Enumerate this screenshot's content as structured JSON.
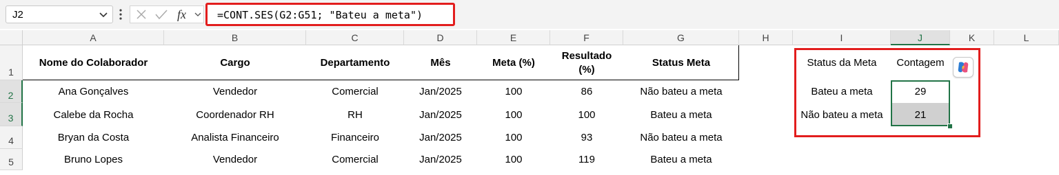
{
  "name_box": {
    "value": "J2"
  },
  "formula_bar": {
    "formula": "=CONT.SES(G2:G51; \"Bateu a meta\")",
    "fx_label": "fx"
  },
  "columns": [
    "A",
    "B",
    "C",
    "D",
    "E",
    "F",
    "G",
    "H",
    "I",
    "J",
    "K",
    "L"
  ],
  "selected_column": "J",
  "rows": [
    "1",
    "2",
    "3",
    "4",
    "5"
  ],
  "selected_rows": [
    "2",
    "3"
  ],
  "table": {
    "headers": [
      "Nome do Colaborador",
      "Cargo",
      "Departamento",
      "Mês",
      "Meta (%)",
      "Resultado (%)",
      "Status Meta"
    ],
    "header_result_line1": "Resultado",
    "header_result_line2": "(%)",
    "data": [
      [
        "Ana Gonçalves",
        "Vendedor",
        "Comercial",
        "Jan/2025",
        "100",
        "86",
        "Não bateu a meta"
      ],
      [
        "Calebe da Rocha",
        "Coordenador RH",
        "RH",
        "Jan/2025",
        "100",
        "100",
        "Bateu a meta"
      ],
      [
        "Bryan da Costa",
        "Analista Financeiro",
        "Financeiro",
        "Jan/2025",
        "100",
        "93",
        "Não bateu a meta"
      ],
      [
        "Bruno Lopes",
        "Vendedor",
        "Comercial",
        "Jan/2025",
        "100",
        "119",
        "Bateu a meta"
      ]
    ]
  },
  "summary": {
    "header_status": "Status da Meta",
    "header_count": "Contagem",
    "rows": [
      {
        "label": "Bateu a meta",
        "count": "29"
      },
      {
        "label": "Não bateu a meta",
        "count": "21"
      }
    ]
  },
  "colors": {
    "highlight_red": "#e21d1d",
    "excel_green": "#217346",
    "selected_fill": "#d0d0d0"
  },
  "icons": [
    "chevron-down-icon",
    "more-vertical-icon",
    "cancel-icon",
    "enter-check-icon",
    "function-icon",
    "copilot-icon"
  ]
}
